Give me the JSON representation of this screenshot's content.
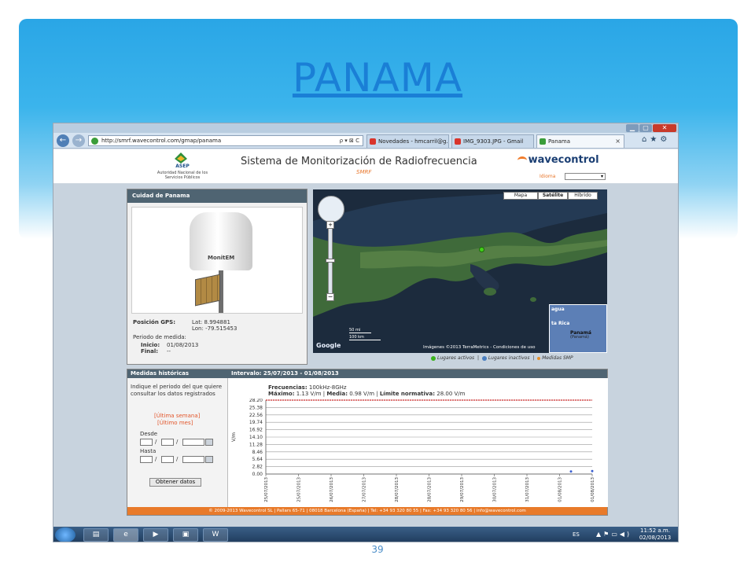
{
  "slide": {
    "title": "PANAMA",
    "page_number": "39"
  },
  "browser": {
    "window_controls": {
      "minimize": "▁",
      "maximize": "▢",
      "close": "✕"
    },
    "nav": {
      "back": "←",
      "forward": "→"
    },
    "address": "http://smrf.wavecontrol.com/gmap/panama",
    "address_tools": "ρ ▾ ⊠ C",
    "tabs": [
      {
        "label": "Novedades - hmcarril@g...",
        "color": "#d9342b"
      },
      {
        "label": "IMG_9303.JPG - Gmail",
        "color": "#d9342b"
      },
      {
        "label": "Panama",
        "color": "#3a9d3a",
        "close": "×"
      }
    ],
    "right_icons": "⌂★⚙"
  },
  "site": {
    "org_short": "ASEP",
    "org_sub": "Autoridad Nacional de los Servicios Públicos",
    "title": "Sistema de Monitorización de Radiofrecuencia",
    "subtitle": "SMRF",
    "brand": "wavecontrol",
    "language_label": "Idioma",
    "language_value": "▾"
  },
  "station": {
    "header": "Cuidad de Panama",
    "device_brand": "MonitEM",
    "gps_label": "Posición GPS:",
    "lat": "Lat: 8.994881",
    "lon": "Lon: -79.515453",
    "period_label": "Periodo de medida:",
    "start_label": "Inicio:",
    "start_value": "01/08/2013",
    "end_label": "Final:",
    "end_value": "--"
  },
  "map": {
    "types": {
      "map": "Mapa",
      "satellite": "Satélite",
      "hybrid": "Híbrido"
    },
    "zoom_in": "+",
    "zoom_out": "−",
    "inset_labels": [
      "agua",
      "ta Rica",
      "Panamá",
      "(Panamá)"
    ],
    "scale_mi": "50 mi",
    "scale_km": "100 km",
    "google": "Google",
    "credit": "Imágenes ©2013 TerraMetrics - Condiciones de uso",
    "legend": {
      "active": "Lugares activos",
      "inactive": "Lugares inactivos",
      "smp": "Medidas SMP"
    }
  },
  "history": {
    "title": "Medidas históricas",
    "interval": "Intervalo: 25/07/2013 - 01/08/2013",
    "instructions": "Indique el periodo del que quiere consultar los datos registrados",
    "last_week": "[Última semana]",
    "last_month": "[Último mes]",
    "from_label": "Desde",
    "to_label": "Hasta",
    "date_sep": "/",
    "get_button": "Obtener datos",
    "freq_label": "Frecuencias:",
    "freq_value": "100kHz-8GHz",
    "max_label": "Máximo:",
    "max_value": "1.13 V/m",
    "mean_label": "Media:",
    "mean_value": "0.98 V/m",
    "limit_label": "Límite normativa:",
    "limit_value": "28.00 V/m",
    "footer": "© 2009-2013 Wavecontrol SL | Pallars 65-71 | 08018 Barcelona (España) | Tel: +34 93 320 80 55 | Fax: +34 93 320 80 56 | info@wavecontrol.com"
  },
  "chart_data": {
    "type": "line",
    "ylabel": "V/m",
    "ylim": [
      0,
      28.2
    ],
    "yticks": [
      "28.20",
      "25.38",
      "22.56",
      "19.74",
      "16.92",
      "14.10",
      "11.28",
      "8.46",
      "5.64",
      "2.82",
      "0.00"
    ],
    "x": [
      "25/07/2013",
      "25/07/2013",
      "26/07/2013",
      "27/07/2013",
      "28/07/2013",
      "28/07/2013",
      "29/07/2013",
      "30/07/2013",
      "31/07/2013",
      "01/08/2013",
      "01/08/2013"
    ],
    "limit_series": {
      "name": "Límite normativa",
      "value": 28.2,
      "color": "#d42a2a"
    },
    "points": [
      {
        "x_index": 9.35,
        "y": 0.98
      },
      {
        "x_index": 10.0,
        "y": 1.13
      }
    ],
    "grid": true
  },
  "taskbar": {
    "apps": [
      "▤",
      "e",
      "▶",
      "▣",
      "W"
    ],
    "lang": "ES",
    "tray": "▲⚑▭◀)",
    "time": "11:52 a.m.",
    "date": "02/08/2013"
  }
}
